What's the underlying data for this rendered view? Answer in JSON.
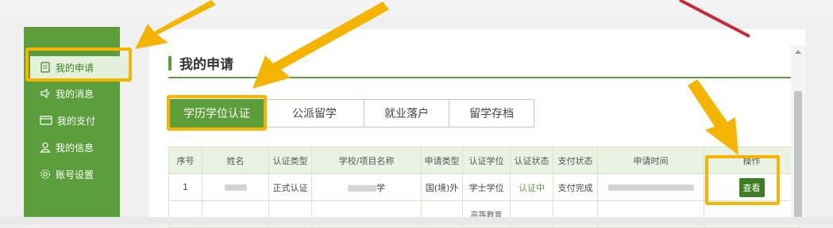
{
  "sidebar": {
    "items": [
      {
        "label": "我的申请",
        "icon": "document-icon"
      },
      {
        "label": "我的消息",
        "icon": "speaker-icon"
      },
      {
        "label": "我的支付",
        "icon": "card-icon"
      },
      {
        "label": "我的信息",
        "icon": "user-icon"
      },
      {
        "label": "账号设置",
        "icon": "gear-icon"
      }
    ]
  },
  "main": {
    "title": "我的申请",
    "tabs": [
      "学历学位认证",
      "公派留学",
      "就业落户",
      "留学存档"
    ]
  },
  "table": {
    "headers": [
      "序号",
      "姓名",
      "认证类型",
      "学校/项目名称",
      "申请类型",
      "认证学位",
      "认证状态",
      "支付状态",
      "申请时间",
      "操作"
    ],
    "row": {
      "index": "1",
      "cert_type": "正式认证",
      "school_suffix": "学",
      "app_type": "国(境)外",
      "degree": "学士学位",
      "status": "认证中",
      "pay_status": "支付完成",
      "action": "查看"
    },
    "partial_row_text": "高等教育"
  },
  "colors": {
    "brand": "#5b9e3b",
    "highlight": "#f5b400",
    "arrow_red": "#c8283c"
  }
}
